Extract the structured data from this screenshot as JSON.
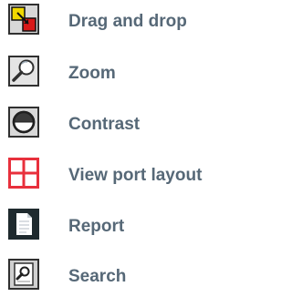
{
  "colors": {
    "label_text": "#566877",
    "icon_frame": "#303030",
    "drag_yellow": "#f0d800",
    "drag_red": "#d81818",
    "grid_red": "#e8303c",
    "report_dark": "#1f2a2e"
  },
  "menu": {
    "items": [
      {
        "label": "Drag and drop",
        "icon": "drag-and-drop-icon"
      },
      {
        "label": "Zoom",
        "icon": "magnifier-icon"
      },
      {
        "label": "Contrast",
        "icon": "contrast-circle-icon"
      },
      {
        "label": "View port layout",
        "icon": "grid-layout-icon"
      },
      {
        "label": "Report",
        "icon": "document-icon"
      },
      {
        "label": "Search",
        "icon": "search-document-icon"
      }
    ]
  }
}
